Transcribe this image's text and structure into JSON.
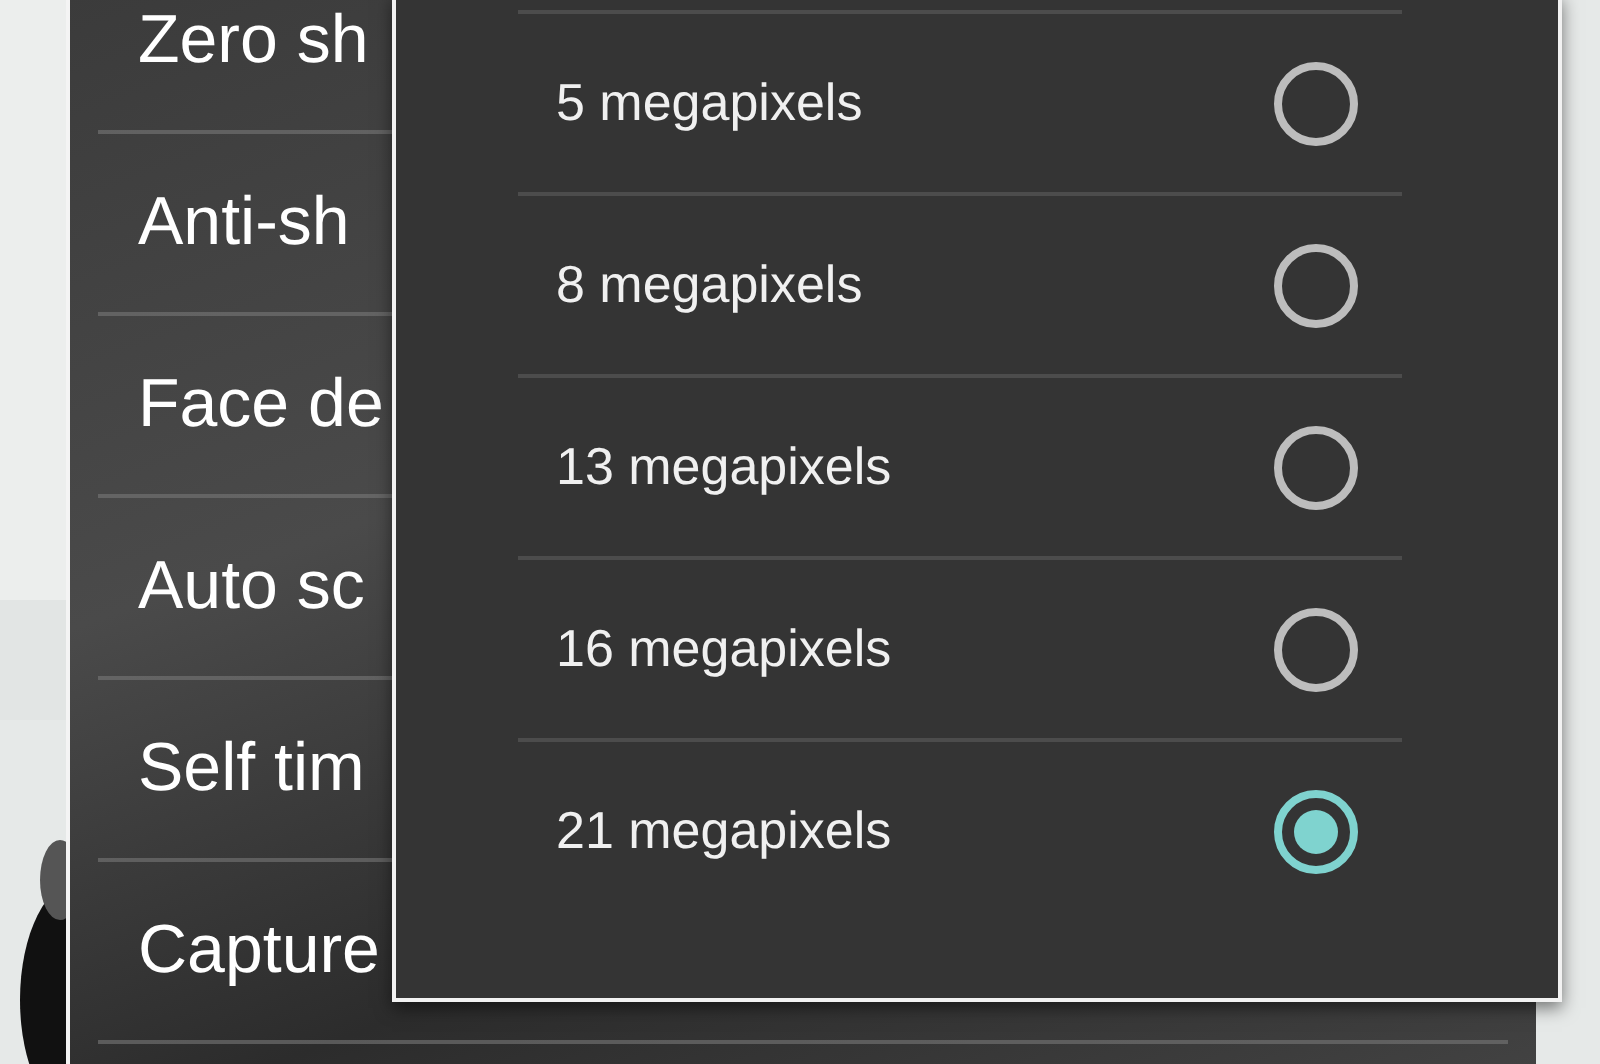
{
  "settings": [
    {
      "label": "Zero sh"
    },
    {
      "label": "Anti-sh"
    },
    {
      "label": "Face de"
    },
    {
      "label": "Auto sc"
    },
    {
      "label": "Self tim"
    },
    {
      "label": "Capture"
    }
  ],
  "dialog": {
    "options": [
      {
        "label": "5 megapixels",
        "selected": false
      },
      {
        "label": "8 megapixels",
        "selected": false
      },
      {
        "label": "13 megapixels",
        "selected": false
      },
      {
        "label": "16 megapixels",
        "selected": false
      },
      {
        "label": "21 megapixels",
        "selected": true
      }
    ]
  }
}
